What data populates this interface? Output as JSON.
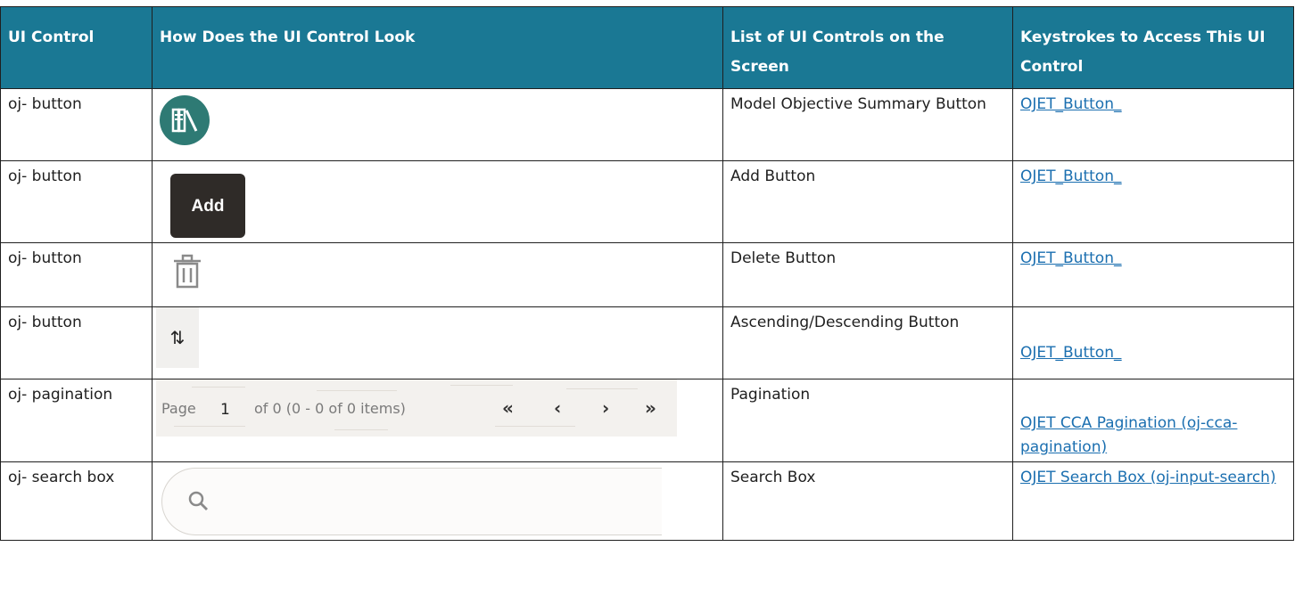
{
  "headers": {
    "ui_control": "UI Control",
    "look": "How Does the UI Control Look",
    "list": "List of UI Controls on the Screen",
    "keystrokes": "Keystrokes to Access This UI Control"
  },
  "rows": [
    {
      "control": "oj- button",
      "look_icon": "model-objective-summary-icon",
      "list": "Model Objective Summary Button",
      "link": "OJET_Button_"
    },
    {
      "control": "oj- button",
      "look_label": "Add",
      "list": "Add Button",
      "link": "OJET_Button_"
    },
    {
      "control": "oj- button",
      "look_icon": "trash-icon",
      "list": "Delete Button",
      "link": "OJET_Button_"
    },
    {
      "control": "oj- button",
      "look_icon": "sort-icon",
      "look_label": "⇅",
      "list": "Ascending/Descending Button",
      "link": "OJET_Button_"
    },
    {
      "control": "oj- pagination",
      "list": "Pagination",
      "link": "OJET CCA Pagination (oj-cca-pagination)",
      "pager": {
        "page_label": "Page",
        "page_number": "1",
        "summary": "of 0 (0 - 0 of 0 items)",
        "first": "«",
        "prev": "‹",
        "next": "›",
        "last": "»"
      }
    },
    {
      "control": "oj- search box",
      "look_icon": "search-icon",
      "list": "Search Box",
      "link": "OJET Search Box (oj-input-search)"
    }
  ],
  "colors": {
    "header_bg": "#1a7894",
    "link": "#1b6fb0",
    "circle_btn": "#2e7a74",
    "add_btn": "#2f2b28"
  }
}
